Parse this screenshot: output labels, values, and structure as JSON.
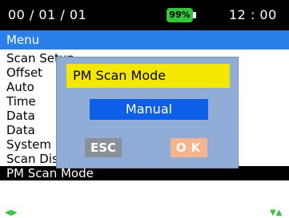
{
  "status": {
    "date": "00 / 01 / 01",
    "battery": "99%",
    "time": "12 : 00",
    "battery_color": "#33c83a"
  },
  "menu": {
    "title": "Menu",
    "items": [
      {
        "label": "Scan Setup"
      },
      {
        "label": "Offset"
      },
      {
        "label": "Auto"
      },
      {
        "label": "Time"
      },
      {
        "label": "Data"
      },
      {
        "label": "Data"
      },
      {
        "label": "System Info"
      },
      {
        "label": "Scan Display"
      },
      {
        "label": "PM Scan Mode"
      }
    ],
    "selected_index": 8
  },
  "dialog": {
    "title": "PM Scan Mode",
    "value": "Manual",
    "esc_label": "ESC",
    "ok_label": "OK"
  },
  "footer": {
    "left_icon": "left-right-arrows-icon",
    "right_icon": "up-down-arrows-icon"
  },
  "colors": {
    "accent": "#2a80e8",
    "dialog_bg": "#8fadd7",
    "dialog_title_bg": "#f5e800",
    "value_bg": "#0c5fe6",
    "esc_bg": "#8a9098",
    "ok_bg": "#f7b48c"
  }
}
